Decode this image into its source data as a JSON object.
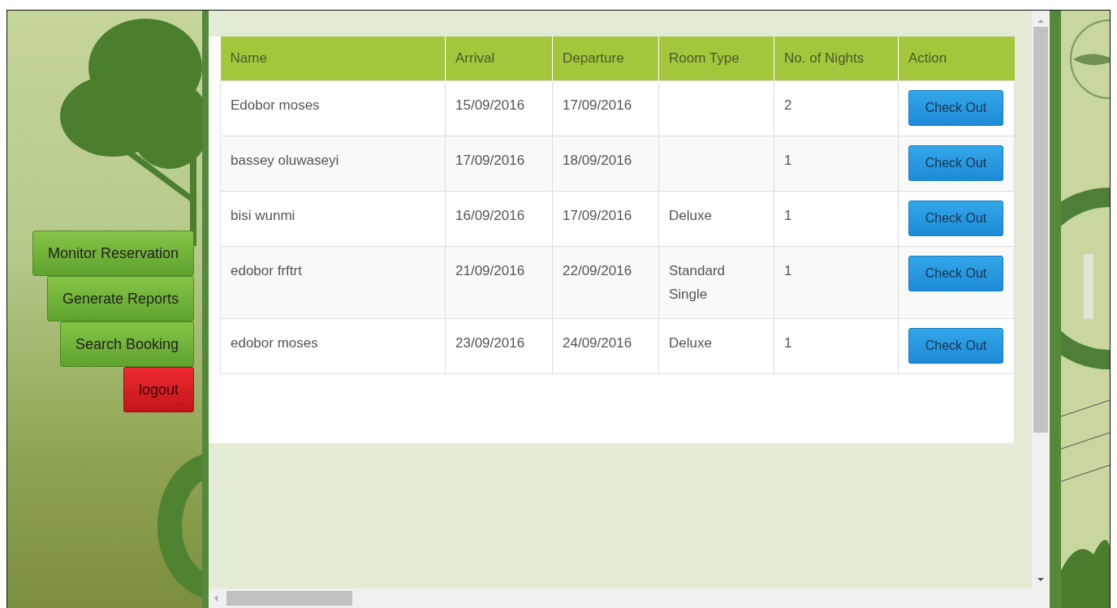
{
  "sidebar": {
    "items": [
      {
        "label": "Monitor Reservation",
        "kind": "nav"
      },
      {
        "label": "Generate Reports",
        "kind": "nav"
      },
      {
        "label": "Search Booking",
        "kind": "nav"
      },
      {
        "label": "logout",
        "kind": "logout"
      }
    ]
  },
  "table": {
    "columns": [
      "Name",
      "Arrival",
      "Departure",
      "Room Type",
      "No. of Nights",
      "Action"
    ],
    "rows": [
      {
        "name": "Edobor moses",
        "arrival": "15/09/2016",
        "departure": "17/09/2016",
        "room_type": "",
        "nights": "2",
        "action": "Check Out"
      },
      {
        "name": "bassey oluwaseyi",
        "arrival": "17/09/2016",
        "departure": "18/09/2016",
        "room_type": "",
        "nights": "1",
        "action": "Check Out"
      },
      {
        "name": "bisi wunmi",
        "arrival": "16/09/2016",
        "departure": "17/09/2016",
        "room_type": "Deluxe",
        "nights": "1",
        "action": "Check Out"
      },
      {
        "name": "edobor frftrt",
        "arrival": "21/09/2016",
        "departure": "22/09/2016",
        "room_type": "Standard Single",
        "nights": "1",
        "action": "Check Out"
      },
      {
        "name": "edobor moses",
        "arrival": "23/09/2016",
        "departure": "24/09/2016",
        "room_type": "Deluxe",
        "nights": "1",
        "action": "Check Out"
      }
    ]
  }
}
